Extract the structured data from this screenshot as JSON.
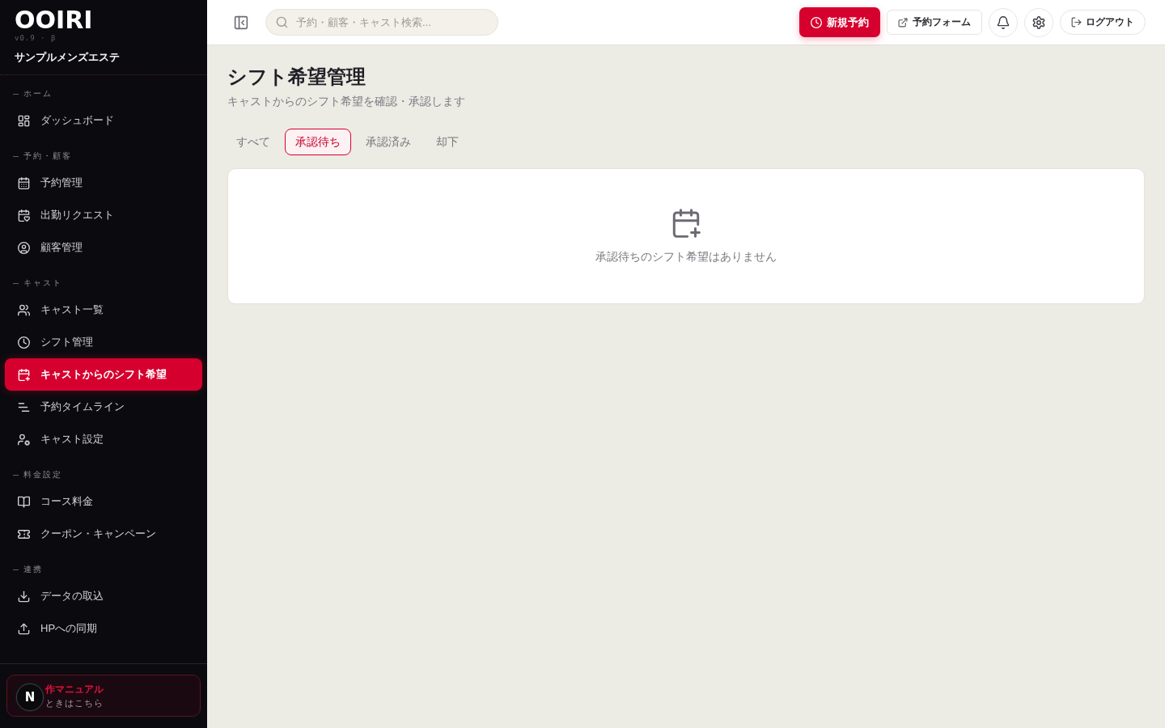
{
  "sidebar": {
    "logo": "OOIRI",
    "version": "v0.9 · β",
    "shop_name": "サンプルメンズエステ",
    "sections": [
      {
        "label": "ホーム",
        "items": [
          {
            "label": "ダッシュボード",
            "selected": false
          }
        ]
      },
      {
        "label": "予約・顧客",
        "items": [
          {
            "label": "予約管理",
            "selected": false
          },
          {
            "label": "出勤リクエスト",
            "selected": false
          },
          {
            "label": "顧客管理",
            "selected": false
          }
        ]
      },
      {
        "label": "キャスト",
        "items": [
          {
            "label": "キャスト一覧",
            "selected": false
          },
          {
            "label": "シフト管理",
            "selected": false
          },
          {
            "label": "キャストからのシフト希望",
            "selected": true
          },
          {
            "label": "予約タイムライン",
            "selected": false
          },
          {
            "label": "キャスト設定",
            "selected": false
          }
        ]
      },
      {
        "label": "料金設定",
        "items": [
          {
            "label": "コース料金",
            "selected": false
          },
          {
            "label": "クーポン・キャンペーン",
            "selected": false
          }
        ]
      },
      {
        "label": "連携",
        "items": [
          {
            "label": "データの取込",
            "selected": false
          },
          {
            "label": "HPへの同期",
            "selected": false
          }
        ]
      }
    ],
    "help_card": {
      "title": "作マニュアル",
      "subtitle": "ときはこちら"
    }
  },
  "dev_badge": {
    "label": "N"
  },
  "topbar": {
    "search": {
      "placeholder": "予約・顧客・キャスト検索..."
    },
    "buttons": [
      {
        "kind": "primary",
        "label": "新規予約"
      },
      {
        "kind": "outline",
        "label": "予約フォーム"
      },
      {
        "kind": "round"
      },
      {
        "kind": "round"
      },
      {
        "kind": "pill",
        "label": "ログアウト"
      }
    ]
  },
  "page": {
    "title": "シフト希望管理",
    "subtitle": "キャストからのシフト希望を確認・承認します",
    "tabs": [
      {
        "label": "すべて",
        "selected": false
      },
      {
        "label": "承認待ち",
        "selected": true
      },
      {
        "label": "承認済み",
        "selected": false
      },
      {
        "label": "却下",
        "selected": false
      }
    ],
    "empty_state": {
      "message": "承認待ちのシフト希望はありません"
    }
  }
}
